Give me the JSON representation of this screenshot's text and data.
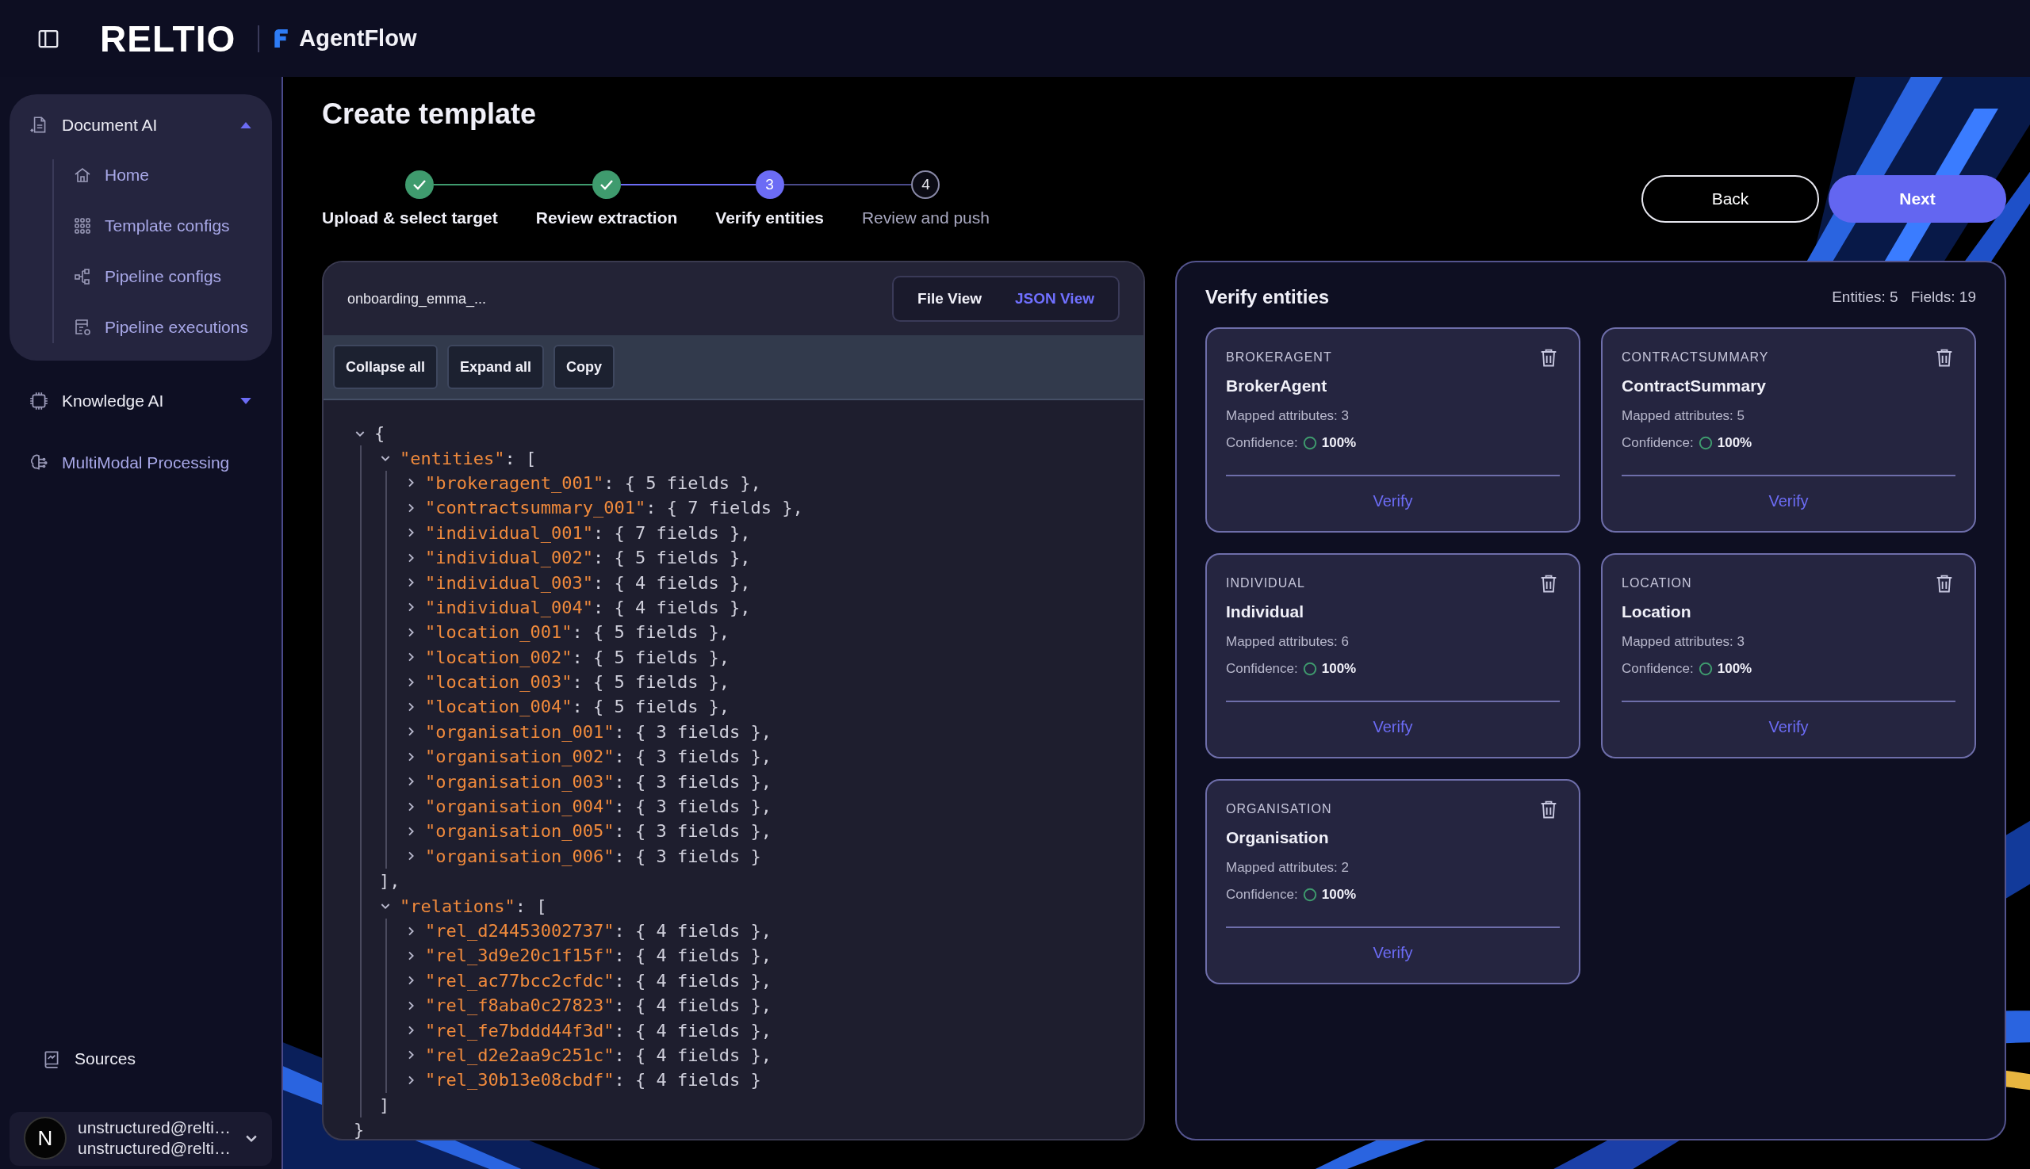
{
  "header": {
    "logo": "RELTIO",
    "product": "AgentFlow"
  },
  "sidebar": {
    "sections": [
      {
        "label": "Document AI",
        "expanded": true,
        "children": [
          {
            "label": "Home"
          },
          {
            "label": "Template configs"
          },
          {
            "label": "Pipeline configs"
          },
          {
            "label": "Pipeline executions"
          }
        ]
      },
      {
        "label": "Knowledge AI",
        "expanded": false
      },
      {
        "label": "MultiModal Processing"
      }
    ],
    "footer_item": {
      "label": "Sources"
    },
    "user": {
      "initial": "N",
      "name": "unstructured@relti…",
      "email": "unstructured@relti…"
    }
  },
  "page": {
    "title": "Create template",
    "steps": [
      {
        "label": "Upload & select target",
        "kind": "done"
      },
      {
        "label": "Review extraction",
        "kind": "done"
      },
      {
        "number": "3",
        "label": "Verify entities",
        "kind": "current"
      },
      {
        "number": "4",
        "label": "Review and push",
        "kind": "pending"
      }
    ],
    "buttons": {
      "back": "Back",
      "next": "Next"
    }
  },
  "json_panel": {
    "file_name": "onboarding_emma_...",
    "views": [
      {
        "label": "File View",
        "selected": false
      },
      {
        "label": "JSON View",
        "selected": true
      }
    ],
    "toolbar": [
      "Collapse all",
      "Expand all",
      "Copy"
    ],
    "tree": {
      "value": "{",
      "expanded": true,
      "close": "}",
      "children": [
        {
          "key": "\"entities\"",
          "value": ": [",
          "expanded": true,
          "close": "],",
          "children": [
            {
              "key": "\"brokeragent_001\"",
              "value": ": { 5 fields },",
              "expanded": false
            },
            {
              "key": "\"contractsummary_001\"",
              "value": ": { 7 fields },",
              "expanded": false
            },
            {
              "key": "\"individual_001\"",
              "value": ": { 7 fields },",
              "expanded": false
            },
            {
              "key": "\"individual_002\"",
              "value": ": { 5 fields },",
              "expanded": false
            },
            {
              "key": "\"individual_003\"",
              "value": ": { 4 fields },",
              "expanded": false
            },
            {
              "key": "\"individual_004\"",
              "value": ": { 4 fields },",
              "expanded": false
            },
            {
              "key": "\"location_001\"",
              "value": ": { 5 fields },",
              "expanded": false
            },
            {
              "key": "\"location_002\"",
              "value": ": { 5 fields },",
              "expanded": false
            },
            {
              "key": "\"location_003\"",
              "value": ": { 5 fields },",
              "expanded": false
            },
            {
              "key": "\"location_004\"",
              "value": ": { 5 fields },",
              "expanded": false
            },
            {
              "key": "\"organisation_001\"",
              "value": ": { 3 fields },",
              "expanded": false
            },
            {
              "key": "\"organisation_002\"",
              "value": ": { 3 fields },",
              "expanded": false
            },
            {
              "key": "\"organisation_003\"",
              "value": ": { 3 fields },",
              "expanded": false
            },
            {
              "key": "\"organisation_004\"",
              "value": ": { 3 fields },",
              "expanded": false
            },
            {
              "key": "\"organisation_005\"",
              "value": ": { 3 fields },",
              "expanded": false
            },
            {
              "key": "\"organisation_006\"",
              "value": ": { 3 fields }",
              "expanded": false
            }
          ]
        },
        {
          "key": "\"relations\"",
          "value": ": [",
          "expanded": true,
          "close": "]",
          "children": [
            {
              "key": "\"rel_d24453002737\"",
              "value": ": { 4 fields },",
              "expanded": false
            },
            {
              "key": "\"rel_3d9e20c1f15f\"",
              "value": ": { 4 fields },",
              "expanded": false
            },
            {
              "key": "\"rel_ac77bcc2cfdc\"",
              "value": ": { 4 fields },",
              "expanded": false
            },
            {
              "key": "\"rel_f8aba0c27823\"",
              "value": ": { 4 fields },",
              "expanded": false
            },
            {
              "key": "\"rel_fe7bddd44f3d\"",
              "value": ": { 4 fields },",
              "expanded": false
            },
            {
              "key": "\"rel_d2e2aa9c251c\"",
              "value": ": { 4 fields },",
              "expanded": false
            },
            {
              "key": "\"rel_30b13e08cbdf\"",
              "value": ": { 4 fields }",
              "expanded": false
            }
          ]
        }
      ]
    }
  },
  "verify_panel": {
    "title": "Verify entities",
    "entities_count": "Entities: 5",
    "fields_count": "Fields: 19",
    "cards": [
      {
        "type": "BROKERAGENT",
        "name": "BrokerAgent",
        "mapped": "Mapped attributes: 3",
        "confidence_label": "Confidence:",
        "confidence": "100%",
        "action": "Verify"
      },
      {
        "type": "CONTRACTSUMMARY",
        "name": "ContractSummary",
        "mapped": "Mapped attributes: 5",
        "confidence_label": "Confidence:",
        "confidence": "100%",
        "action": "Verify"
      },
      {
        "type": "INDIVIDUAL",
        "name": "Individual",
        "mapped": "Mapped attributes: 6",
        "confidence_label": "Confidence:",
        "confidence": "100%",
        "action": "Verify"
      },
      {
        "type": "LOCATION",
        "name": "Location",
        "mapped": "Mapped attributes: 3",
        "confidence_label": "Confidence:",
        "confidence": "100%",
        "action": "Verify"
      },
      {
        "type": "ORGANISATION",
        "name": "Organisation",
        "mapped": "Mapped attributes: 2",
        "confidence_label": "Confidence:",
        "confidence": "100%",
        "action": "Verify"
      }
    ]
  }
}
